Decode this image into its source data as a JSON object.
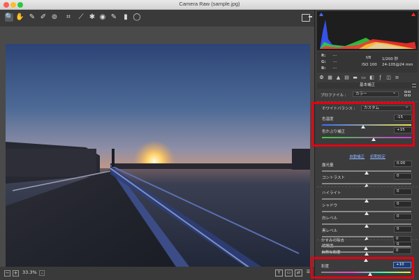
{
  "window": {
    "title": "Camera Raw (sample.jpg)"
  },
  "toolbar": {
    "tools": [
      {
        "name": "zoom-tool-icon",
        "glyph": "🔍"
      },
      {
        "name": "hand-tool-icon",
        "glyph": "✋"
      },
      {
        "name": "white-balance-tool-icon",
        "glyph": "✎"
      },
      {
        "name": "color-sampler-tool-icon",
        "glyph": "✐"
      },
      {
        "name": "targeted-adjustment-tool-icon",
        "glyph": "⊚"
      },
      {
        "name": "crop-tool-icon",
        "glyph": "⌗"
      },
      {
        "name": "straighten-tool-icon",
        "glyph": "⟋"
      },
      {
        "name": "spot-removal-tool-icon",
        "glyph": "✱"
      },
      {
        "name": "red-eye-tool-icon",
        "glyph": "◉"
      },
      {
        "name": "adjustment-brush-icon",
        "glyph": "✎"
      },
      {
        "name": "graduated-filter-icon",
        "glyph": "▮"
      },
      {
        "name": "radial-filter-icon",
        "glyph": "◯"
      }
    ]
  },
  "statusbar": {
    "zoom": "33.3%",
    "zoom_dropdown": "⌄",
    "before_after": "Y"
  },
  "info": {
    "r_label": "R:",
    "g_label": "G:",
    "b_label": "B:",
    "r_value": "---",
    "g_value": "---",
    "b_value": "---",
    "aperture": "f/8",
    "shutter": "1/200 秒",
    "iso": "ISO 100",
    "lens": "24-105@24 mm"
  },
  "panel": {
    "section_title": "基本補正",
    "profile_label": "プロファイル :",
    "profile_value": "カラー",
    "wb_label": "ホワイトバランス :",
    "wb_value": "カスタム",
    "auto_link": "自動補正",
    "default_link": "初期設定"
  },
  "sliders": [
    {
      "label": "色温度",
      "value": "-15",
      "pos": 0.46
    },
    {
      "label": "色かぶり補正",
      "value": "+15",
      "pos": 0.58
    },
    {
      "label": "露光量",
      "value": "0.00",
      "pos": 0.5
    },
    {
      "label": "コントラスト",
      "value": "0",
      "pos": 0.5
    },
    {
      "label": "ハイライト",
      "value": "0",
      "pos": 0.5
    },
    {
      "label": "シャドウ",
      "value": "0",
      "pos": 0.5
    },
    {
      "label": "白レベル",
      "value": "0",
      "pos": 0.5
    },
    {
      "label": "黒レベル",
      "value": "0",
      "pos": 0.5
    },
    {
      "label": "明瞭度",
      "value": "0",
      "pos": 0.5
    },
    {
      "label": "かすみの除去",
      "value": "0",
      "pos": 0.5
    },
    {
      "label": "自然な彩度",
      "value": "0",
      "pos": 0.5
    },
    {
      "label": "彩度",
      "value": "+10",
      "pos": 0.55
    }
  ],
  "colors": {
    "highlight_box": "#e60012",
    "panel_bg": "#3c3c3c"
  }
}
